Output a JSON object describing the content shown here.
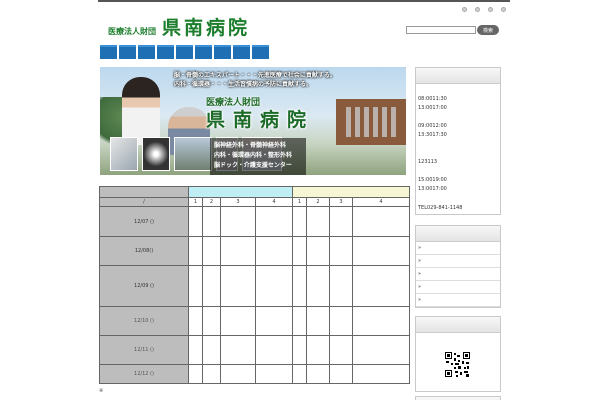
{
  "header": {
    "corp": "医療法人財団",
    "name": "県南病院",
    "util_links": [
      "",
      "",
      "",
      ""
    ]
  },
  "search": {
    "placeholder": "",
    "button_label": "検索"
  },
  "nav": {
    "items": [
      "",
      "",
      "",
      "",
      "",
      "",
      "",
      "",
      ""
    ]
  },
  "banner": {
    "line1": "脳・脊髄のエキスパート・・・先進医療で社会に貢献する。",
    "line2": "内科・循環器・・・生活習慣病の予防に貢献する。",
    "corp": "医療法人財団",
    "name": "県南病院",
    "dept1": "脳神経外科・脊髄神経外科",
    "dept2": "内科・循環器内科・整形外科",
    "dept3": "脳ドック・介護支援センター"
  },
  "schedule": {
    "corner": "/",
    "am_cols": [
      "1",
      "2",
      "3",
      "4"
    ],
    "pm_cols": [
      "1",
      "2",
      "3",
      "4"
    ],
    "rows": [
      {
        "date": "12/07 ()"
      },
      {
        "date": "12/08()"
      },
      {
        "date": "12/09 ()"
      },
      {
        "date": "12/10 ()"
      },
      {
        "date": "12/11 ()"
      },
      {
        "date": "12/12 ()"
      }
    ]
  },
  "footnote": "※",
  "sidebar": {
    "hours": {
      "r1": "08:0011:30",
      "r2": "13:0017:00",
      "r3": "09:0012:00",
      "r4": "13:3017:30",
      "r5": "123113",
      "r6": "15:0019:00",
      "r7": "13:0017:00",
      "tel": "TEL029-841-1148"
    },
    "links": [
      "»",
      "»",
      "»",
      "»",
      "»"
    ]
  },
  "colors": {
    "brand_green": "#1c7d2c",
    "nav_blue": "#1e6fb3",
    "am_header": "#bfeef4",
    "pm_header": "#f6f6d4",
    "date_col": "#bdbdbd"
  }
}
